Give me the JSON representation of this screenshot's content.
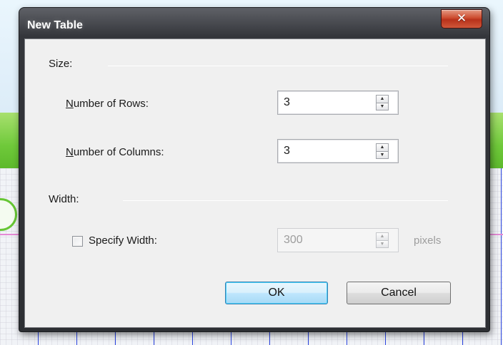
{
  "dialog": {
    "title": "New Table",
    "close_glyph": "✕"
  },
  "size_group": {
    "label": "Size:",
    "rows": {
      "label_access_key": "N",
      "label_rest": "umber of Rows:",
      "value": "3"
    },
    "columns": {
      "label_access_key": "N",
      "label_rest": "umber of Columns:",
      "value": "3"
    }
  },
  "width_group": {
    "label": "Width:",
    "specify_width": {
      "label": "Specify Width:",
      "checked": false
    },
    "width_value": "300",
    "unit": "pixels"
  },
  "buttons": {
    "ok": "OK",
    "cancel": "Cancel"
  },
  "icons": {
    "close": "close-icon",
    "spin_up": "spin-up-icon",
    "spin_down": "spin-down-icon"
  },
  "colors": {
    "title_bar": "#34363b",
    "close_button": "#c8452a",
    "default_button_border": "#3c7fb1",
    "background_green": "#6fc93a",
    "background_grid_line": "#2b45e0",
    "background_pink_line": "#e58ad5"
  }
}
